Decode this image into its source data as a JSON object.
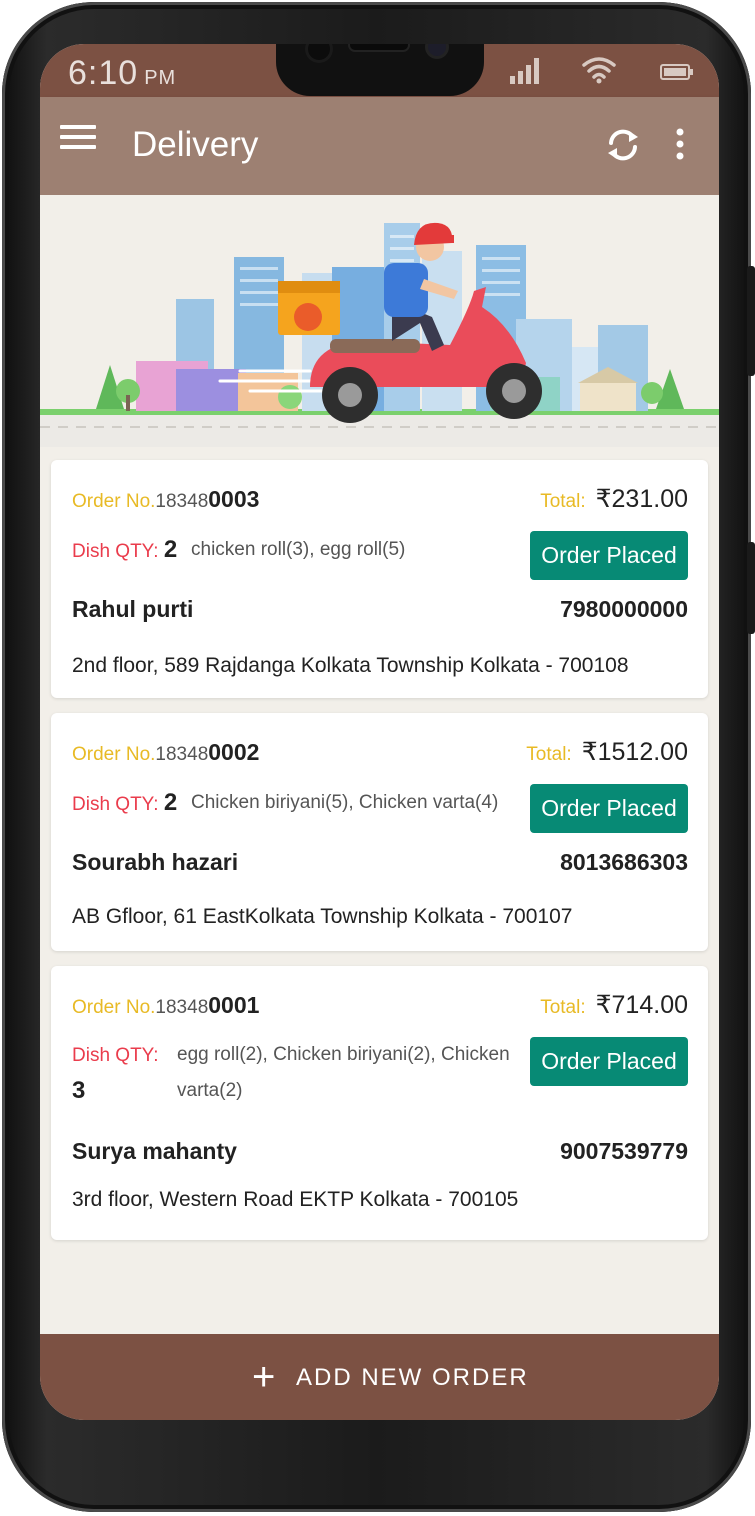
{
  "status_bar": {
    "time": "6:10",
    "ampm": "PM"
  },
  "app_bar": {
    "title": "Delivery"
  },
  "colors": {
    "app_bar": "#9d8072",
    "status_bar": "#7c5143",
    "accent_green": "#078a75",
    "order_label": "#e8ba25",
    "dish_label": "#ea3c4c"
  },
  "labels": {
    "order_no": "Order No.",
    "dish_qty": "Dish QTY:",
    "total": "Total:"
  },
  "orders": [
    {
      "prefix": "18348",
      "suffix": "0003",
      "total": "₹231.00",
      "qty": "2",
      "items": "chicken roll(3), egg roll(5)",
      "status": "Order Placed",
      "name": "Rahul purti",
      "phone": "7980000000",
      "address": "2nd floor, 589 Rajdanga Kolkata Township Kolkata - 700108"
    },
    {
      "prefix": "18348",
      "suffix": "0002",
      "total": "₹1512.00",
      "qty": "2",
      "items": "Chicken biriyani(5), Chicken varta(4)",
      "status": "Order Placed",
      "name": "Sourabh hazari",
      "phone": "8013686303",
      "address": "AB Gfloor, 61 EastKolkata Township Kolkata - 700107"
    },
    {
      "prefix": "18348",
      "suffix": "0001",
      "total": "₹714.00",
      "qty": "3",
      "items_line1": "egg roll(2), Chicken biriyani(2), Chicken",
      "items_line2": "varta(2)",
      "status": "Order Placed",
      "name": "Surya mahanty",
      "phone": "9007539779",
      "address": "3rd floor, Western Road EKTP Kolkata - 700105"
    }
  ],
  "bottom_button": {
    "label": "ADD NEW ORDER"
  }
}
